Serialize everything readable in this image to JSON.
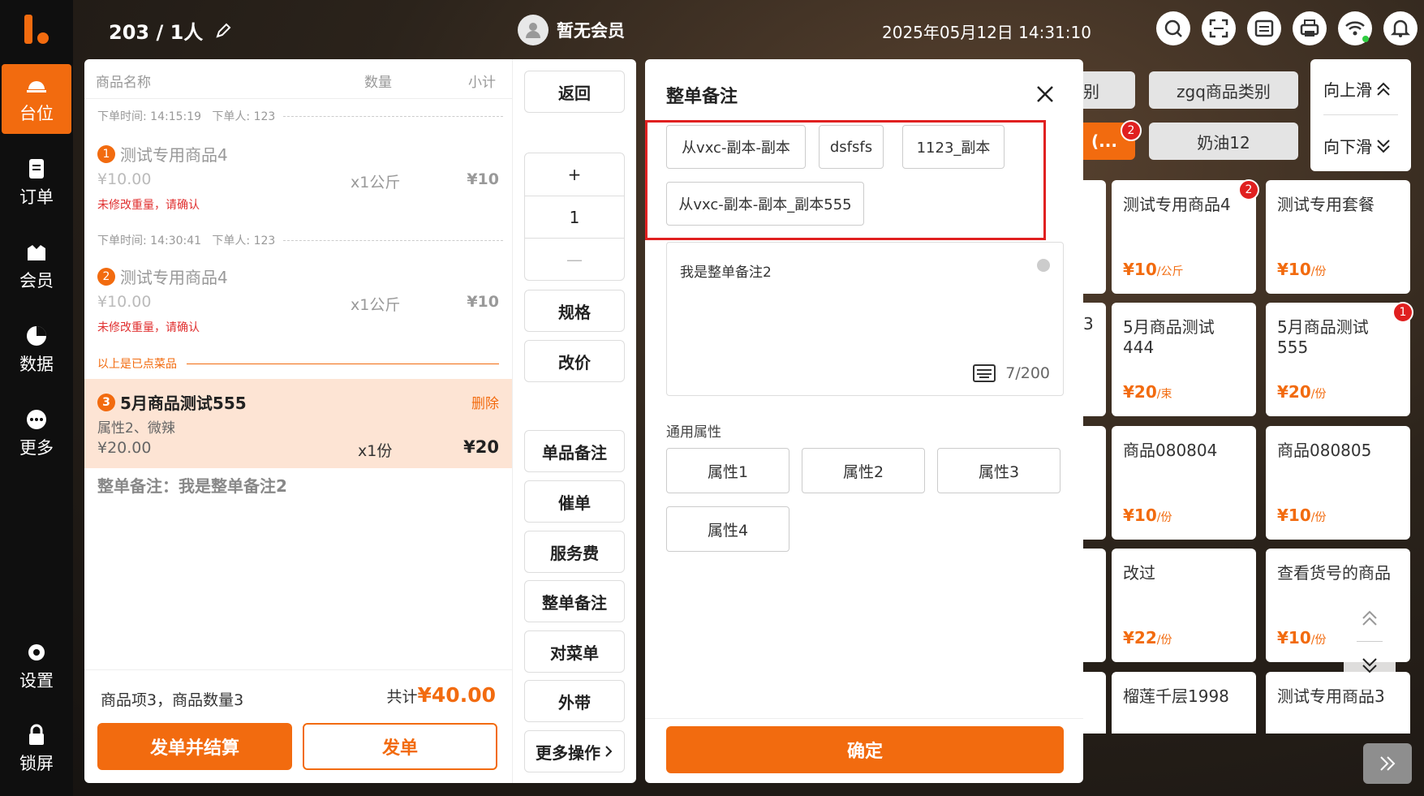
{
  "colors": {
    "accent": "#f26b0f",
    "danger": "#e02020"
  },
  "sidebar": {
    "items": [
      {
        "label": "台位",
        "icon": "table-bell-icon",
        "active": true
      },
      {
        "label": "订单",
        "icon": "order-icon"
      },
      {
        "label": "会员",
        "icon": "member-icon"
      },
      {
        "label": "数据",
        "icon": "chart-icon"
      },
      {
        "label": "更多",
        "icon": "more-icon"
      },
      {
        "label": "设置",
        "icon": "gear-icon"
      },
      {
        "label": "锁屏",
        "icon": "lock-icon"
      }
    ]
  },
  "header": {
    "table": "203 / 1人",
    "member": "暂无会员",
    "datetime": "2025年05月12日 14:31:10"
  },
  "order": {
    "col_name": "商品名称",
    "col_qty": "数量",
    "col_sub": "小计",
    "batch1": {
      "time": "下单时间: 14:15:19",
      "by": "下单人: 123"
    },
    "batch2": {
      "time": "下单时间: 14:30:41",
      "by": "下单人: 123"
    },
    "items": [
      {
        "no": "1",
        "name": "测试专用商品4",
        "price": "¥10.00",
        "qty": "x1公斤",
        "sub": "¥10",
        "warn": "未修改重量，请确认"
      },
      {
        "no": "2",
        "name": "测试专用商品4",
        "price": "¥10.00",
        "qty": "x1公斤",
        "sub": "¥10",
        "warn": "未修改重量，请确认"
      },
      {
        "no": "3",
        "name": "5月商品测试555",
        "attr": "属性2、微辣",
        "price": "¥20.00",
        "qty": "x1份",
        "sub": "¥20",
        "del": "删除"
      }
    ],
    "ordered_sep": "以上是已点菜品",
    "whole_note": "整单备注：我是整单备注2",
    "summary_left": "商品项3，商品数量3",
    "summary_total_label": "共计",
    "summary_total": "¥40.00",
    "btn_settle": "发单并结算",
    "btn_send": "发单"
  },
  "actions": {
    "back": "返回",
    "plus": "+",
    "qty": "1",
    "minus": "—",
    "spec": "规格",
    "price": "改价",
    "item_note": "单品备注",
    "urge": "催单",
    "service": "服务费",
    "whole_note": "整单备注",
    "check": "对菜单",
    "takeout": "外带",
    "more": "更多操作"
  },
  "modal": {
    "title": "整单备注",
    "tags": [
      "从vxc-副本-副本",
      "dsfsfs",
      "1123_副本",
      "从vxc-副本-副本_副本555"
    ],
    "note": "我是整单备注2",
    "count": "7/200",
    "general": "通用属性",
    "attrs": [
      "属性1",
      "属性2",
      "属性3",
      "属性4"
    ],
    "confirm": "确定"
  },
  "categories": {
    "c1": "别",
    "c2": "zgq商品类别",
    "c3": "(...",
    "c3_badge": "2",
    "c4": "奶油12",
    "up": "向上滑",
    "down": "向下滑"
  },
  "products": [
    {
      "name": "测试专用商品4",
      "price": "¥10",
      "unit": "/公斤",
      "badge": "2"
    },
    {
      "name": "测试专用套餐",
      "price": "¥10",
      "unit": "/份"
    },
    {
      "name": "5月商品测试444",
      "price": "¥20",
      "unit": "/束"
    },
    {
      "name": "5月商品测试555",
      "price": "¥20",
      "unit": "/份",
      "badge": "1"
    },
    {
      "name": "商品080804",
      "price": "¥10",
      "unit": "/份"
    },
    {
      "name": "商品080805",
      "price": "¥10",
      "unit": "/份"
    },
    {
      "name": "改过",
      "price": "¥22",
      "unit": "/份"
    },
    {
      "name": "查看货号的商品",
      "price": "¥10",
      "unit": "/份"
    },
    {
      "name": "榴莲千层1998"
    },
    {
      "name": "测试专用商品3"
    }
  ],
  "partial": {
    "p1": "3"
  }
}
